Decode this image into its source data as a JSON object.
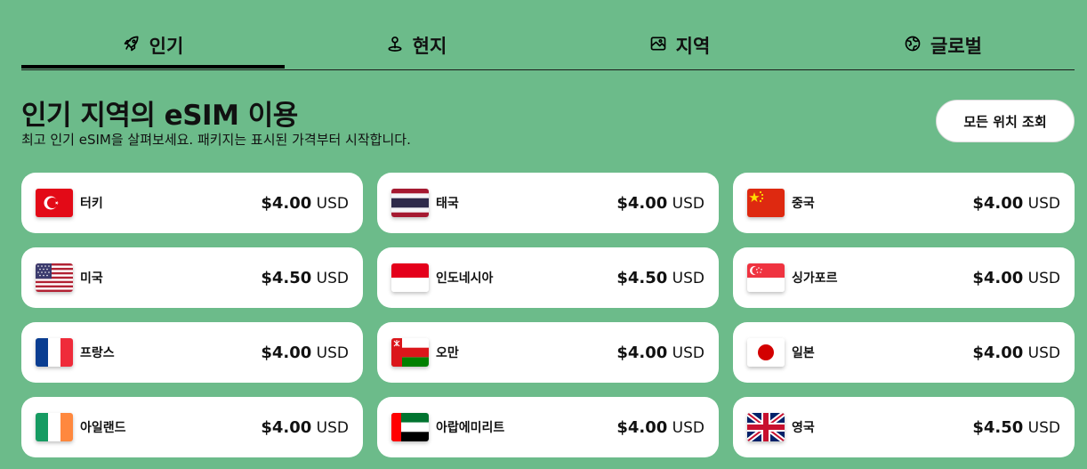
{
  "tabs": [
    {
      "label": "인기",
      "icon": "rocket-icon",
      "active": true
    },
    {
      "label": "현지",
      "icon": "location-pin-icon",
      "active": false
    },
    {
      "label": "지역",
      "icon": "map-icon",
      "active": false
    },
    {
      "label": "글로벌",
      "icon": "globe-icon",
      "active": false
    }
  ],
  "header": {
    "title": "인기 지역의 eSIM 이용",
    "subtitle": "최고 인기 eSIM을 살펴보세요. 패키지는 표시된 가격부터 시작합니다.",
    "view_all_label": "모든 위치 조회"
  },
  "destinations": [
    {
      "name": "터키",
      "price": "$4.00",
      "currency": "USD",
      "flag": "turkey-flag"
    },
    {
      "name": "태국",
      "price": "$4.00",
      "currency": "USD",
      "flag": "thailand-flag"
    },
    {
      "name": "중국",
      "price": "$4.00",
      "currency": "USD",
      "flag": "china-flag"
    },
    {
      "name": "미국",
      "price": "$4.50",
      "currency": "USD",
      "flag": "usa-flag"
    },
    {
      "name": "인도네시아",
      "price": "$4.50",
      "currency": "USD",
      "flag": "indonesia-flag"
    },
    {
      "name": "싱가포르",
      "price": "$4.00",
      "currency": "USD",
      "flag": "singapore-flag"
    },
    {
      "name": "프랑스",
      "price": "$4.00",
      "currency": "USD",
      "flag": "france-flag"
    },
    {
      "name": "오만",
      "price": "$4.00",
      "currency": "USD",
      "flag": "oman-flag"
    },
    {
      "name": "일본",
      "price": "$4.00",
      "currency": "USD",
      "flag": "japan-flag"
    },
    {
      "name": "아일랜드",
      "price": "$4.00",
      "currency": "USD",
      "flag": "ireland-flag"
    },
    {
      "name": "아랍에미리트",
      "price": "$4.00",
      "currency": "USD",
      "flag": "uae-flag"
    },
    {
      "name": "영국",
      "price": "$4.50",
      "currency": "USD",
      "flag": "uk-flag"
    }
  ]
}
